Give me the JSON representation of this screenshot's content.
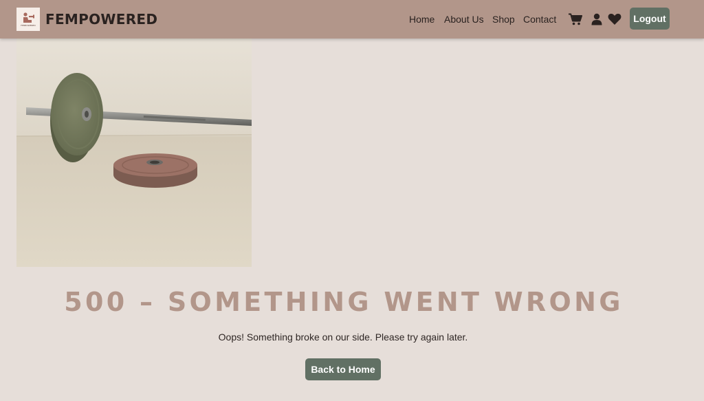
{
  "brand": {
    "name": "FEMPOWERED",
    "logo_text": "FEMPOWERED"
  },
  "nav": {
    "links": [
      "Home",
      "About Us",
      "Shop",
      "Contact"
    ],
    "icons": [
      "cart-icon",
      "user-icon",
      "heart-icon"
    ],
    "logout_label": "Logout"
  },
  "colors": {
    "navbar": "#b2968a",
    "background": "#e6ded9",
    "button": "#617064",
    "title": "#b2968a"
  },
  "error": {
    "title": "500 – SOMETHING WENT WRONG",
    "message": "Oops! Something broke on our side. Please try again later.",
    "button_label": "Back to Home"
  }
}
